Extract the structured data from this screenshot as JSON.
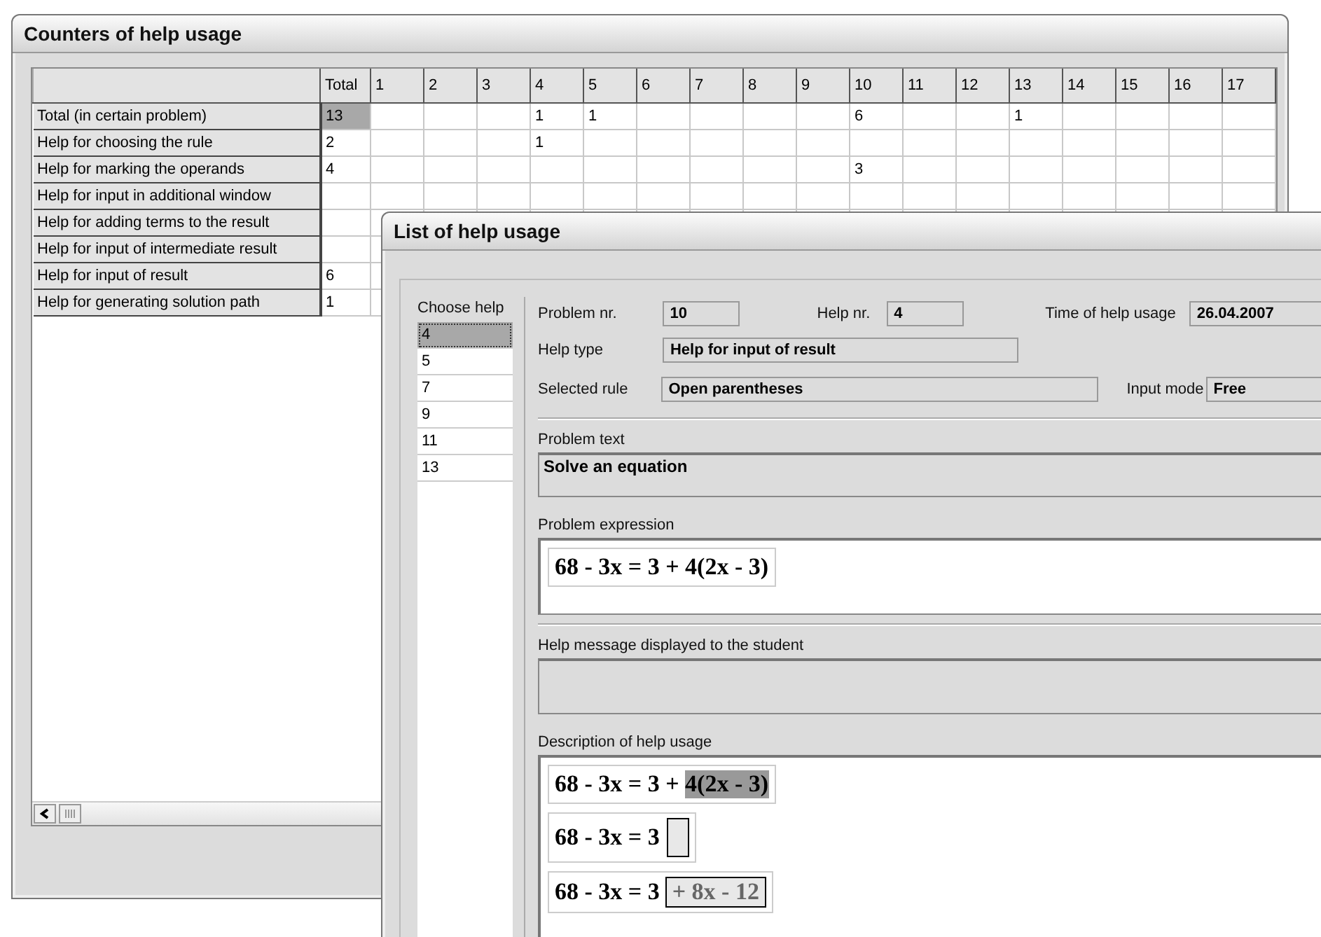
{
  "counters_window": {
    "title": "Counters of help usage",
    "table": {
      "columns": [
        "Total",
        "1",
        "2",
        "3",
        "4",
        "5",
        "6",
        "7",
        "8",
        "9",
        "10",
        "11",
        "12",
        "13",
        "14",
        "15",
        "16",
        "17"
      ],
      "rows": [
        {
          "label": "Total (in certain problem)",
          "selected": true,
          "cells": [
            "13",
            null,
            null,
            null,
            "1",
            "1",
            null,
            null,
            null,
            null,
            "6",
            null,
            null,
            "1",
            null,
            null,
            null,
            null
          ]
        },
        {
          "label": "Help for choosing the rule",
          "selected": false,
          "cells": [
            "2",
            null,
            null,
            null,
            "1",
            null,
            null,
            null,
            null,
            null,
            null,
            null,
            null,
            null,
            null,
            null,
            null,
            null
          ]
        },
        {
          "label": "Help for marking the operands",
          "selected": false,
          "cells": [
            "4",
            null,
            null,
            null,
            null,
            null,
            null,
            null,
            null,
            null,
            "3",
            null,
            null,
            null,
            null,
            null,
            null,
            null
          ]
        },
        {
          "label": "Help for input in additional window",
          "selected": false,
          "cells": [
            null,
            null,
            null
          ]
        },
        {
          "label": "Help for adding terms to the result",
          "selected": false,
          "cells": [
            null,
            null,
            null
          ]
        },
        {
          "label": "Help for input of intermediate result",
          "selected": false,
          "cells": [
            null,
            null,
            null
          ]
        },
        {
          "label": "Help for input of result",
          "selected": false,
          "cells": [
            "6",
            null,
            null
          ]
        },
        {
          "label": "Help for generating solution path",
          "selected": false,
          "cells": [
            "1",
            null,
            null
          ]
        }
      ]
    }
  },
  "help_window": {
    "title": "List of help usage",
    "choose_help": {
      "label": "Choose help",
      "items": [
        {
          "label": "4",
          "selected": true
        },
        {
          "label": "5",
          "selected": false
        },
        {
          "label": "7",
          "selected": false
        },
        {
          "label": "9",
          "selected": false
        },
        {
          "label": "11",
          "selected": false
        },
        {
          "label": "13",
          "selected": false
        }
      ]
    },
    "problem_nr": {
      "label": "Problem nr.",
      "value": "10"
    },
    "help_nr": {
      "label": "Help nr.",
      "value": "4"
    },
    "time": {
      "label": "Time of help usage",
      "value": "26.04.2007"
    },
    "help_type": {
      "label": "Help type",
      "value": "Help for input of result"
    },
    "selected_rule": {
      "label": "Selected rule",
      "value": "Open parentheses"
    },
    "input_mode": {
      "label": "Input mode",
      "value": "Free"
    },
    "problem_text": {
      "label": "Problem text",
      "value": "Solve an equation"
    },
    "problem_expression": {
      "label": "Problem expression",
      "formulas": [
        [
          {
            "kind": "plain",
            "text": "68 - 3x = 3 + 4(2x - 3)"
          }
        ]
      ]
    },
    "help_message": {
      "label": "Help message displayed to the student"
    },
    "description": {
      "label": "Description of help usage",
      "formulas": [
        [
          {
            "kind": "plain",
            "text": "68 - 3x = 3 + "
          },
          {
            "kind": "highlighted",
            "text": "4(2x - 3)"
          }
        ],
        [
          {
            "kind": "plain",
            "text": "68 - 3x = 3"
          },
          {
            "kind": "empty-box"
          }
        ],
        [
          {
            "kind": "plain",
            "text": "68 - 3x = 3"
          },
          {
            "kind": "boxed",
            "text": "+ 8x - 12"
          }
        ]
      ]
    }
  }
}
